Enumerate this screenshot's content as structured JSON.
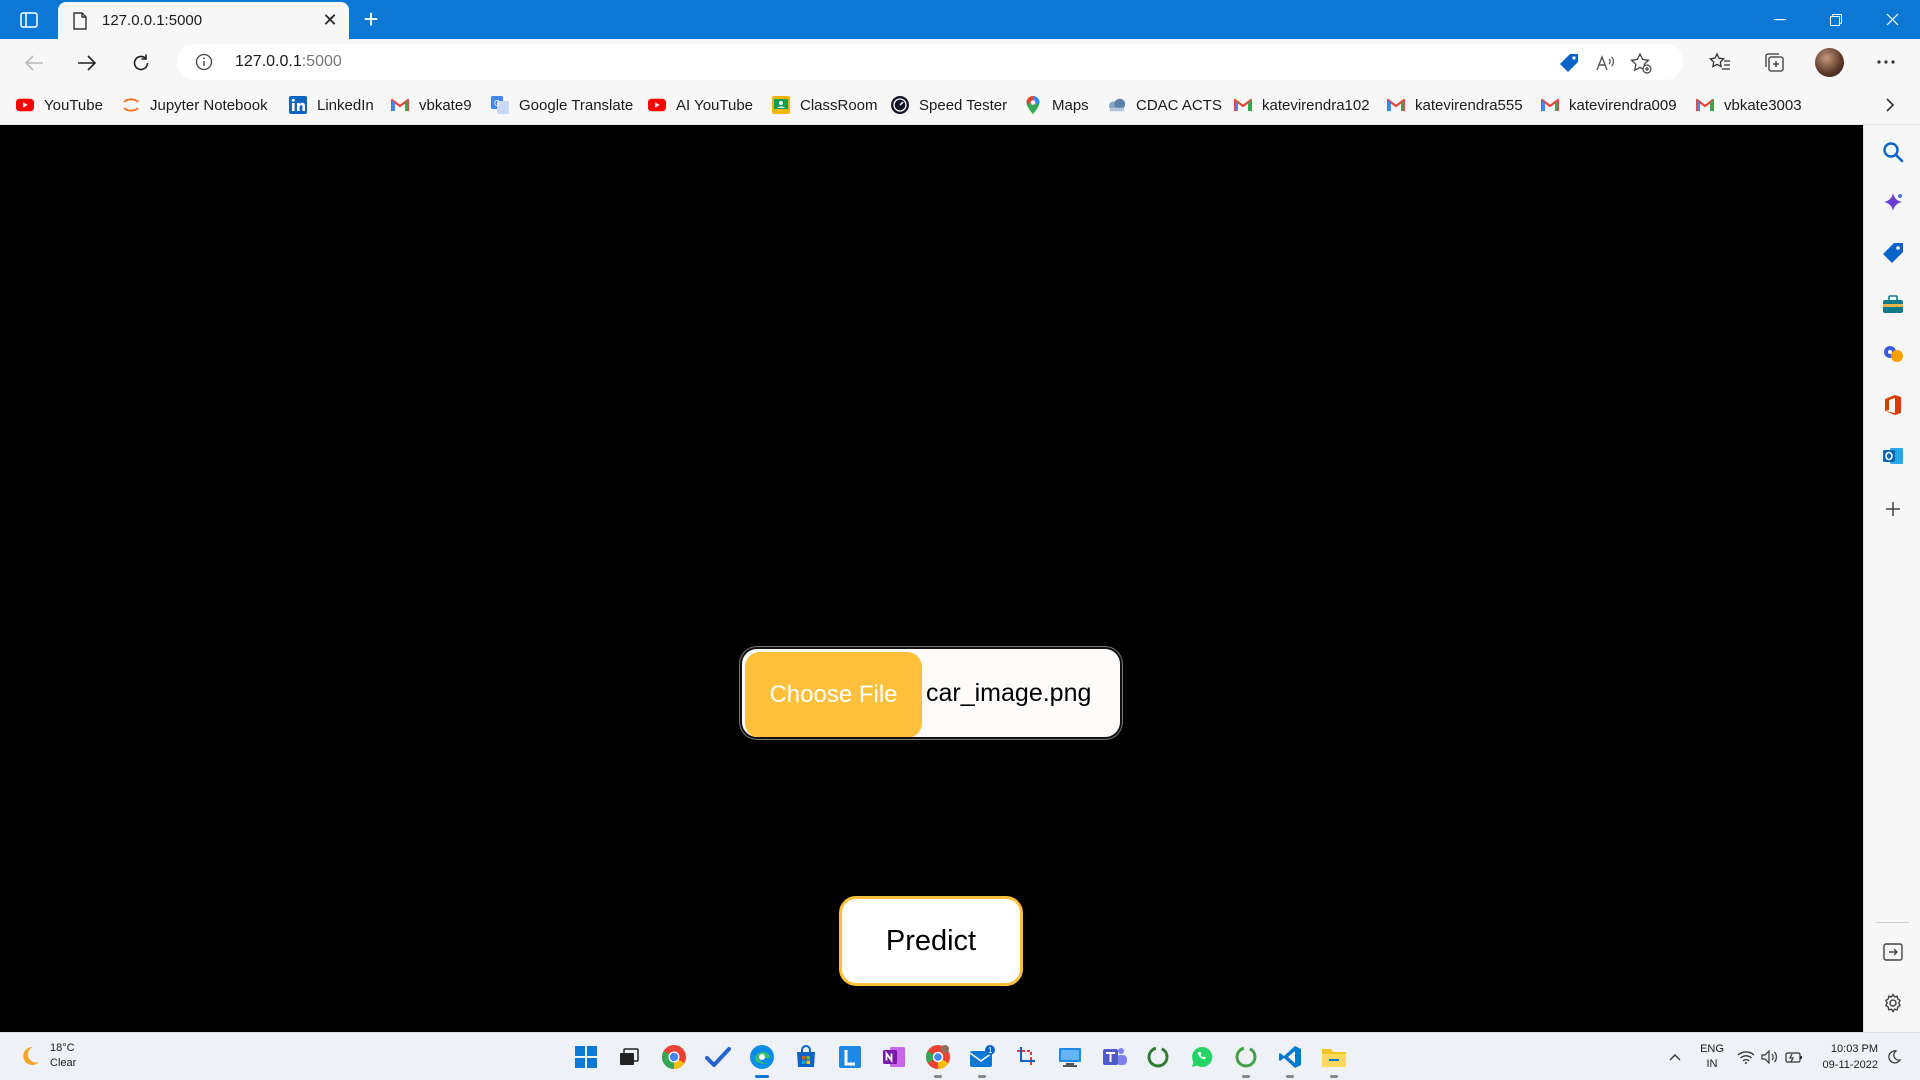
{
  "browser": {
    "tab_title": "127.0.0.1:5000",
    "url_host": "127.0.0.1",
    "url_port": ":5000",
    "accent_color": "#0a78d4"
  },
  "bookmarks": [
    {
      "label": "YouTube",
      "icon": "youtube-icon"
    },
    {
      "label": "Jupyter Notebook",
      "icon": "jupyter-icon"
    },
    {
      "label": "LinkedIn",
      "icon": "linkedin-icon"
    },
    {
      "label": "vbkate9",
      "icon": "gmail-icon"
    },
    {
      "label": "Google Translate",
      "icon": "google-translate-icon"
    },
    {
      "label": "AI YouTube",
      "icon": "youtube-icon"
    },
    {
      "label": "ClassRoom",
      "icon": "classroom-icon"
    },
    {
      "label": "Speed Tester",
      "icon": "speedometer-icon"
    },
    {
      "label": "Maps",
      "icon": "maps-icon"
    },
    {
      "label": "CDAC ACTS",
      "icon": "cdac-icon"
    },
    {
      "label": "katevirendra102",
      "icon": "gmail-icon"
    },
    {
      "label": "katevirendra555",
      "icon": "gmail-icon"
    },
    {
      "label": "katevirendra009",
      "icon": "gmail-icon"
    },
    {
      "label": "vbkate3003",
      "icon": "gmail-icon"
    }
  ],
  "page": {
    "choose_file_label": "Choose File",
    "selected_file": "car_image.png",
    "predict_label": "Predict",
    "accent_color": "#fec03b",
    "background_color": "#000000"
  },
  "taskbar": {
    "weather_temp": "18°C",
    "weather_desc": "Clear",
    "lang_line1": "ENG",
    "lang_line2": "IN",
    "time": "10:03 PM",
    "date": "09-11-2022",
    "mail_badge": "1"
  }
}
